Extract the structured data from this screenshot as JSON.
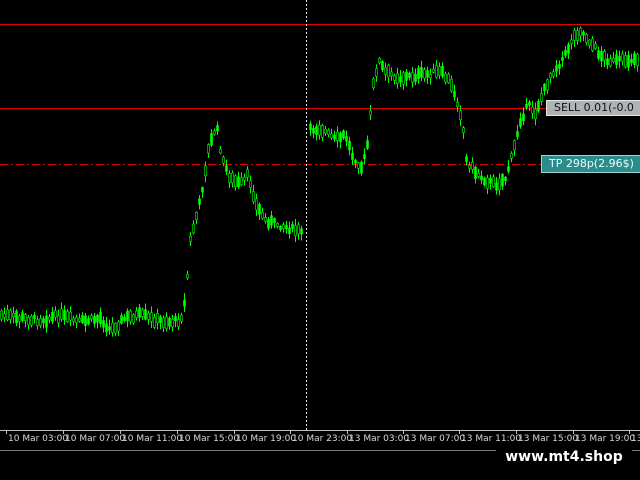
{
  "chart": {
    "background": "#000000",
    "candle_color": "#00ff00",
    "line_color": "#ff0000",
    "crosshair_color": "#ffffff",
    "sell_line_price": 0,
    "levels": {
      "top": "red horizontal line",
      "sell": "red horizontal line",
      "tp": "red dash-dot line"
    }
  },
  "order_labels": {
    "sell": "SELL 0.01(-0.0",
    "tp": "TP 298p(2.96$)"
  },
  "time_axis": {
    "labels": [
      "10 Mar 03:00",
      "10 Mar 07:00",
      "10 Mar 11:00",
      "10 Mar 15:00",
      "10 Mar 19:00",
      "10 Mar 23:00",
      "13 Mar 03:00",
      "13 Mar 07:00",
      "13 Mar 11:00",
      "13 Mar 15:00",
      "13 Mar 19:00",
      "13"
    ]
  },
  "watermark": {
    "text": "www.mt4.shop"
  },
  "colors": {
    "axis_text": "#d8d8d8",
    "sell_tag_bg": "#aeb3b6",
    "tp_tag_bg": "#2c8c8c"
  }
}
